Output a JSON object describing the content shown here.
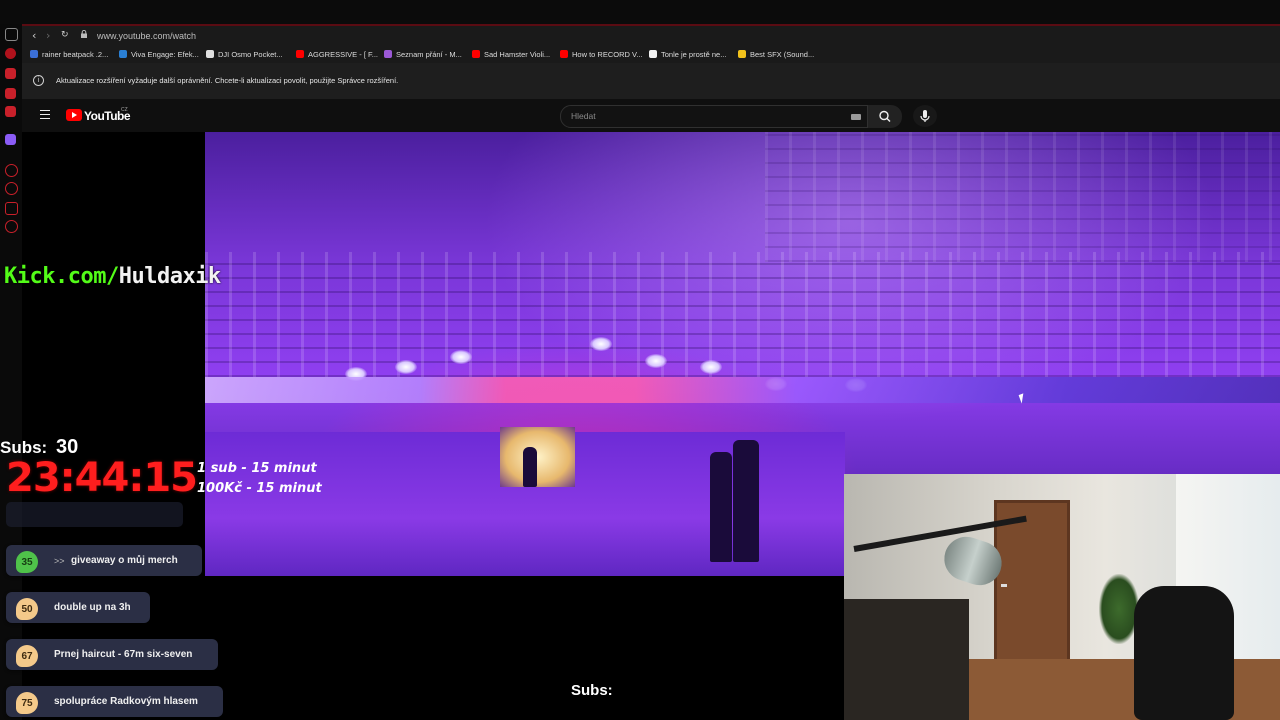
{
  "browser": {
    "url": "www.youtube.com/watch",
    "accent_color": "#5a0b12",
    "bookmarks": [
      {
        "label": "rainer beatpack .2...",
        "icon_color": "#3b6fd6"
      },
      {
        "label": "Viva Engage: Efek...",
        "icon_color": "#2a7fd4"
      },
      {
        "label": "DJI Osmo Pocket...",
        "icon_color": "#e0e0e0"
      },
      {
        "label": "AGGRESSIVE - [ F...",
        "icon_color": "#ff0000"
      },
      {
        "label": "Seznam přání - M...",
        "icon_color": "#9b59d6"
      },
      {
        "label": "Sad Hamster Violi...",
        "icon_color": "#ff0000"
      },
      {
        "label": "How to RECORD V...",
        "icon_color": "#ff0000"
      },
      {
        "label": "Tonle je prostě ne...",
        "icon_color": "#f2f2f2"
      },
      {
        "label": "Best SFX (Sound...",
        "icon_color": "#f2c21b"
      }
    ],
    "infobar_text": "Aktualizace rozšíření vyžaduje další oprávnění. Chcete-li aktualizaci povolit, použijte Správce rozšíření."
  },
  "youtube": {
    "logo_text": "YouTube",
    "country_code": "CZ",
    "search_placeholder": "Hledat"
  },
  "overlay": {
    "kick_domain": "Kick.com/",
    "kick_user": "Huldaxik",
    "subs_label": "Subs:",
    "subs_value": "30",
    "timer": "23:44:15",
    "rates": [
      "1 sub - 15 minut",
      "100Kč - 15 minut"
    ],
    "goals": [
      {
        "number": "35",
        "label": "giveaway o můj merch",
        "color": "#4fc24a",
        "active": true
      },
      {
        "number": "50",
        "label": "double up na 3h",
        "color": "#f4c98a",
        "active": false
      },
      {
        "number": "67",
        "label": "Prnej haircut - 67m six-seven",
        "color": "#f4c98a",
        "active": false
      },
      {
        "number": "75",
        "label": "spolupráce Radkovým hlasem",
        "color": "#f4c98a",
        "active": false
      }
    ],
    "goal_arrows": ">>",
    "bottom_subs_label": "Subs:"
  }
}
